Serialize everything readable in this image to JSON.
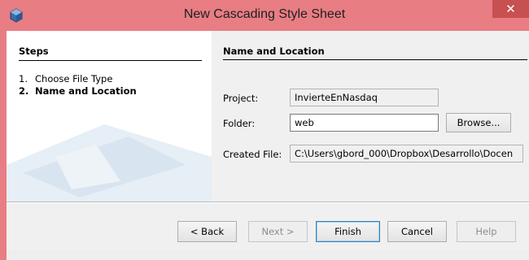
{
  "window": {
    "title": "New Cascading Style Sheet",
    "close_glyph": "✕",
    "title_icon": "netbeans-cube-icon",
    "frame_color": "#e87d83"
  },
  "steps": {
    "heading": "Steps",
    "items": [
      {
        "number": "1.",
        "label": "Choose File Type",
        "current": false
      },
      {
        "number": "2.",
        "label": "Name and Location",
        "current": true
      }
    ]
  },
  "panel": {
    "title": "Name and Location",
    "project_label": "Project:",
    "project_value": "InvierteEnNasdaq",
    "folder_label": "Folder:",
    "folder_value": "web",
    "browse_label": "Browse...",
    "created_label": "Created File:",
    "created_value": "C:\\Users\\gbord_000\\Dropbox\\Desarrollo\\Docen"
  },
  "buttons": {
    "back": "< Back",
    "next": "Next >",
    "finish": "Finish",
    "cancel": "Cancel",
    "help": "Help"
  }
}
